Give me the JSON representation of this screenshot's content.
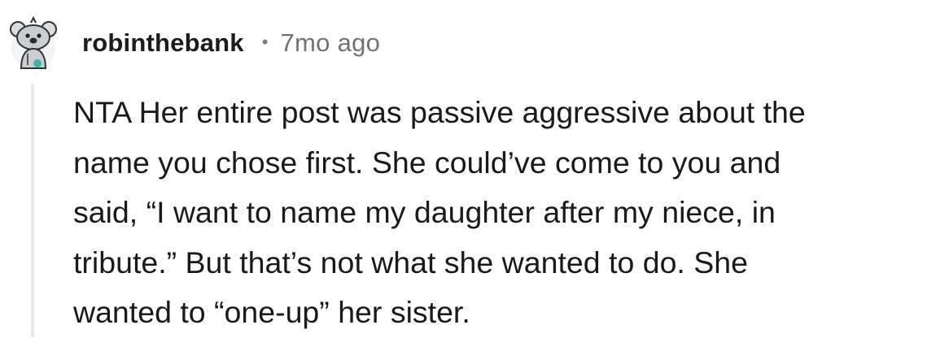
{
  "comment": {
    "author": "robinthebank",
    "separator": "•",
    "timestamp": "7mo ago",
    "avatar_icon": "koala-avatar-icon",
    "body_lines": [
      "NTA Her entire post was passive aggressive about the",
      "name you chose first. She could’ve come to you and",
      "said, “I want to name my daughter after my niece, in",
      "tribute.” But that’s not what she wanted to do. She",
      "wanted to “one-up” her sister."
    ]
  }
}
